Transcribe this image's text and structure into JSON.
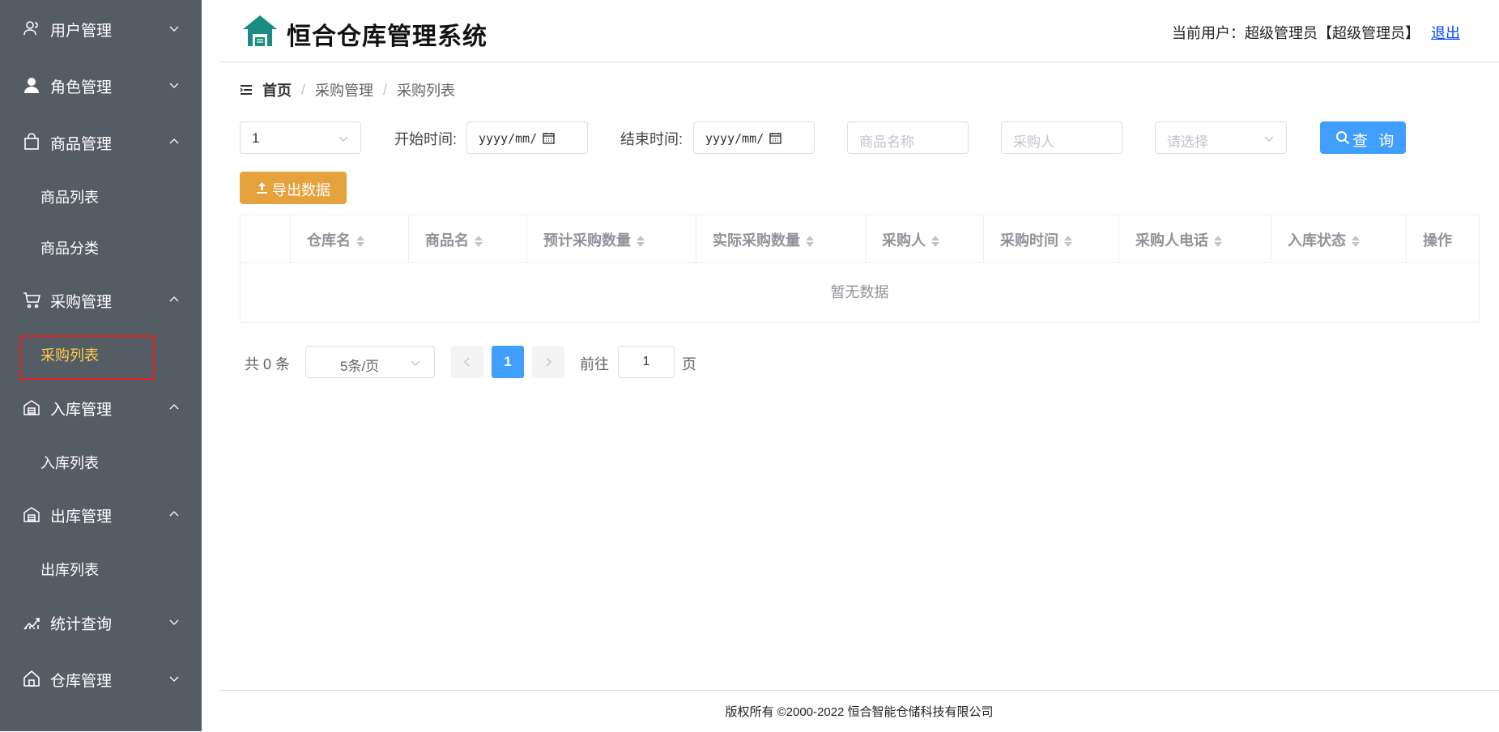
{
  "sidebar": {
    "menus": [
      {
        "label": "用户管理",
        "icon": "users-icon"
      },
      {
        "label": "角色管理",
        "icon": "user-icon"
      },
      {
        "label": "商品管理",
        "icon": "shopping-bag-icon"
      },
      {
        "label": "采购管理",
        "icon": "cart-icon"
      },
      {
        "label": "入库管理",
        "icon": "warehouse-in-icon"
      },
      {
        "label": "出库管理",
        "icon": "warehouse-out-icon"
      },
      {
        "label": "统计查询",
        "icon": "chart-icon"
      },
      {
        "label": "仓库管理",
        "icon": "home-icon"
      }
    ],
    "submenus": {
      "goods_list": "商品列表",
      "goods_category": "商品分类",
      "purchase_list": "采购列表",
      "inbound_list": "入库列表",
      "outbound_list": "出库列表"
    },
    "active_color": "#ffd04b",
    "bg_color": "#545c64"
  },
  "header": {
    "title": "恒合仓库管理系统",
    "user_prefix": "当前用户：超级管理员【超级管理员】",
    "logout": "退出"
  },
  "breadcrumb": [
    "首页",
    "采购管理",
    "采购列表"
  ],
  "filters": {
    "warehouse_value": "1",
    "start_label": "开始时间:",
    "start_placeholder": "yyyy/mm/",
    "end_label": "结束时间:",
    "end_placeholder": "yyyy/mm/",
    "goods_placeholder": "商品名称",
    "buyer_placeholder": "采购人",
    "status_placeholder": "请选择",
    "query_label": "查 询",
    "export_label": "导出数据"
  },
  "table": {
    "columns": [
      "仓库名",
      "商品名",
      "预计采购数量",
      "实际采购数量",
      "采购人",
      "采购时间",
      "采购人电话",
      "入库状态",
      "操作"
    ],
    "empty_text": "暂无数据"
  },
  "pagination": {
    "total_text": "共 0 条",
    "page_size": "5条/页",
    "current_page": "1",
    "goto_label": "前往",
    "goto_value": "1",
    "page_word": "页"
  },
  "footer": {
    "text": "版权所有 ©2000-2022  恒合智能仓储科技有限公司"
  },
  "colors": {
    "primary": "#409eff",
    "warning": "#e6a23c",
    "logo": "#1b8c7f"
  }
}
